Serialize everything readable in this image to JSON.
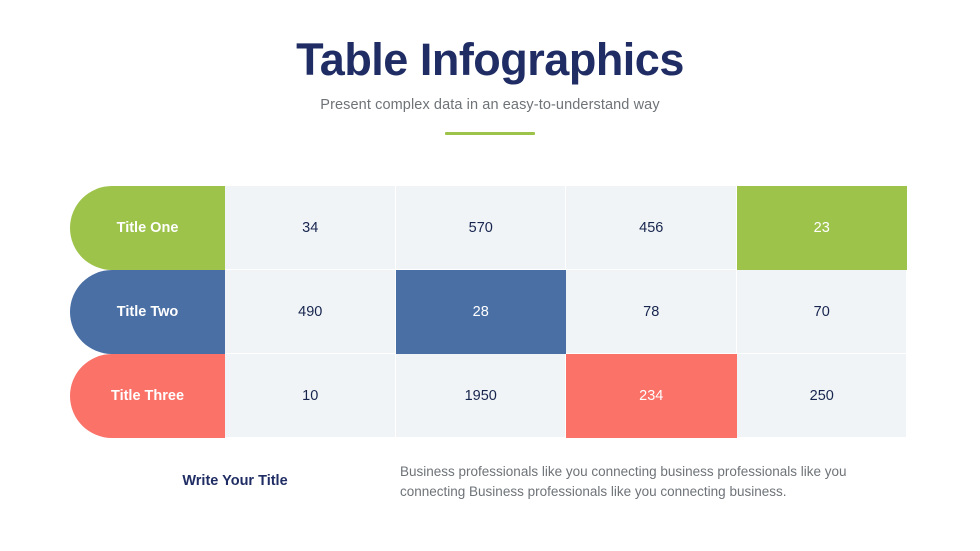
{
  "header": {
    "title": "Table Infographics",
    "subtitle": "Present complex data in an easy-to-understand way"
  },
  "colors": {
    "green": "#9DC34A",
    "blue": "#4A6FA5",
    "coral": "#FA7268",
    "cell_bg": "#F1F4F7",
    "navy": "#1F2D64",
    "gray_text": "#6E7378"
  },
  "table": {
    "rows": [
      {
        "label": "Title One",
        "accent": "#9DC34A",
        "values": [
          "34",
          "570",
          "456",
          "23"
        ],
        "highlight_index": 3
      },
      {
        "label": "Title Two",
        "accent": "#4A6FA5",
        "values": [
          "490",
          "28",
          "78",
          "70"
        ],
        "highlight_index": 1
      },
      {
        "label": "Title Three",
        "accent": "#FA7268",
        "values": [
          "10",
          "1950",
          "234",
          "250"
        ],
        "highlight_index": 2
      }
    ]
  },
  "footer": {
    "title": "Write Your Title",
    "body": "Business professionals like you connecting business professionals like you connecting Business professionals like you connecting business."
  }
}
